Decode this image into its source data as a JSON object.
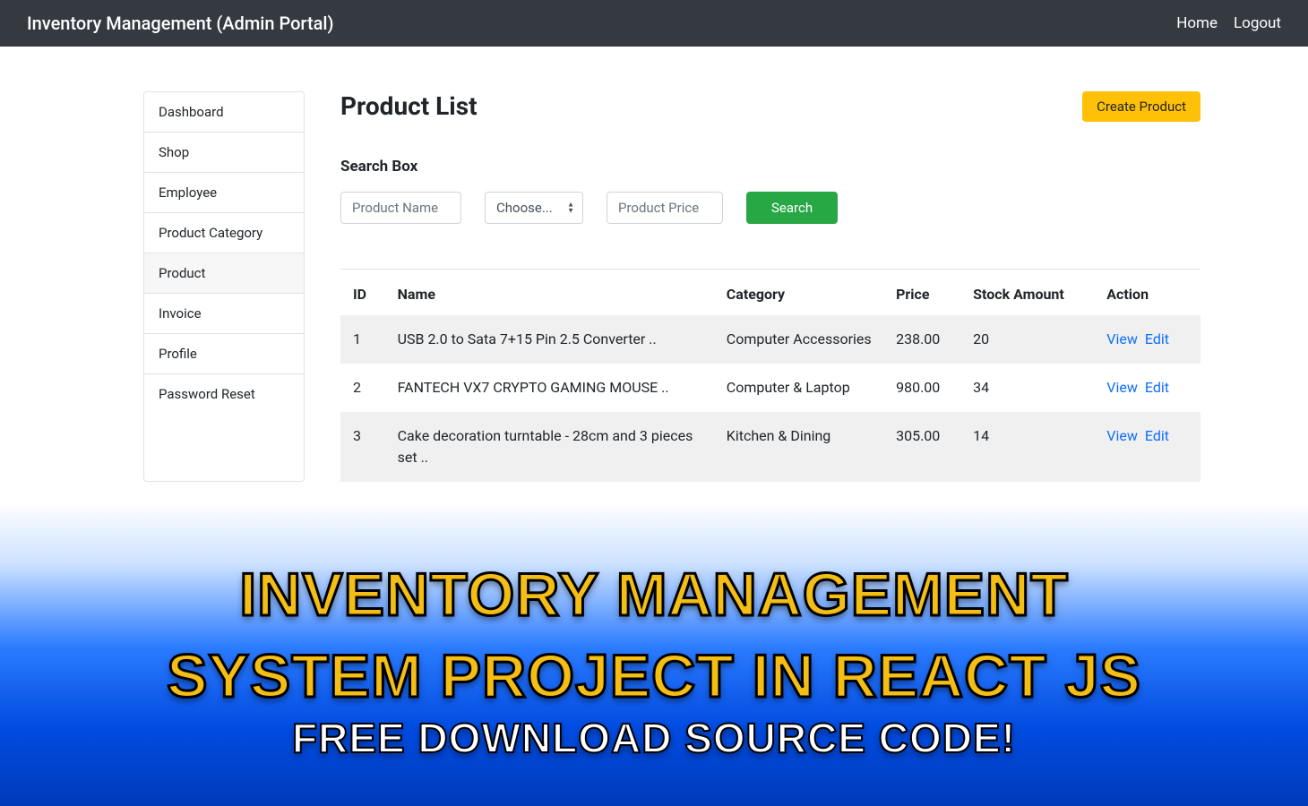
{
  "navbar": {
    "brand": "Inventory Management (Admin Portal)",
    "links": [
      "Home",
      "Logout"
    ]
  },
  "sidebar": {
    "items": [
      "Dashboard",
      "Shop",
      "Employee",
      "Product Category",
      "Product",
      "Invoice",
      "Profile",
      "Password Reset"
    ],
    "active_index": 4
  },
  "page": {
    "title": "Product List",
    "create_button": "Create Product"
  },
  "search": {
    "label": "Search Box",
    "name_placeholder": "Product Name",
    "select_placeholder": "Choose...",
    "price_placeholder": "Product Price",
    "button": "Search"
  },
  "table": {
    "headers": [
      "ID",
      "Name",
      "Category",
      "Price",
      "Stock Amount",
      "Action"
    ],
    "rows": [
      {
        "id": "1",
        "name": "USB 2.0 to Sata 7+15 Pin 2.5 Converter ..",
        "category": "Computer Accessories",
        "price": "238.00",
        "stock": "20"
      },
      {
        "id": "2",
        "name": "FANTECH VX7 CRYPTO GAMING MOUSE ..",
        "category": "Computer & Laptop",
        "price": "980.00",
        "stock": "34"
      },
      {
        "id": "3",
        "name": "Cake decoration turntable - 28cm and 3 pieces set ..",
        "category": "Kitchen & Dining",
        "price": "305.00",
        "stock": "14"
      }
    ],
    "action_view": "View",
    "action_edit": "Edit"
  },
  "overlay": {
    "title_line1": "INVENTORY MANAGEMENT",
    "title_line2": "SYSTEM PROJECT IN REACT JS",
    "subtitle": "FREE DOWNLOAD SOURCE CODE!"
  }
}
